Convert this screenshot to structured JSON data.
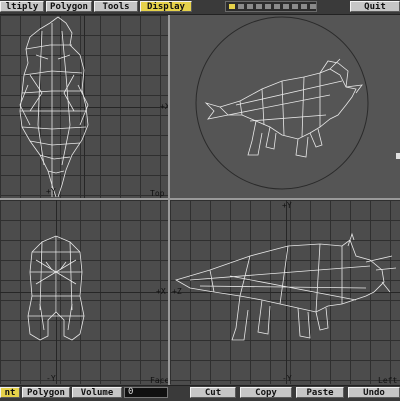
{
  "top_menu": {
    "buttons": [
      {
        "label": "ltiply"
      },
      {
        "label": "Polygon"
      },
      {
        "label": "Tools"
      },
      {
        "label": "Display",
        "active": true
      }
    ],
    "quit_label": "Quit"
  },
  "viewports": {
    "top": {
      "label": "Top",
      "axis_right": "+X",
      "axis_bottom": "+Y"
    },
    "camera": {},
    "face": {
      "label": "Face",
      "axis_right": "+X",
      "axis_bottom": "-Y"
    },
    "left": {
      "label": "Left",
      "axis_top": "+Y",
      "axis_left": "+Z",
      "axis_bottom": "-Y"
    }
  },
  "bottom_bar": {
    "mode_buttons": [
      {
        "label": "nt",
        "active": true
      },
      {
        "label": "Polygon"
      },
      {
        "label": "Volume"
      }
    ],
    "volume_value": "0",
    "edit_buttons": [
      {
        "label": "Cut"
      },
      {
        "label": "Copy"
      },
      {
        "label": "Paste"
      },
      {
        "label": "Undo"
      }
    ]
  },
  "colors": {
    "accent": "#e6d24a",
    "viewport_bg": "#4c4c4c",
    "wireframe": "#e8e8e8"
  }
}
